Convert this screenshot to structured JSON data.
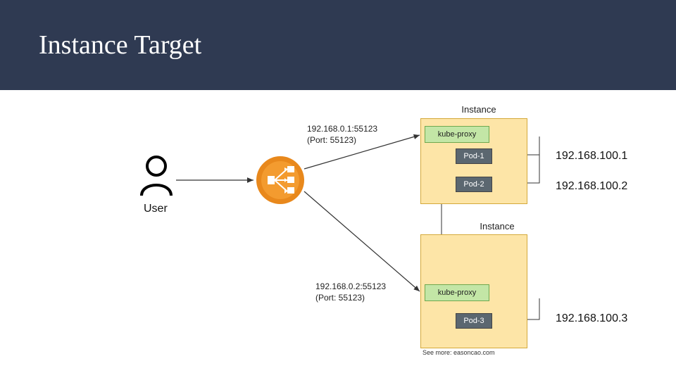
{
  "title": "Instance Target",
  "user_label": "User",
  "lb": {
    "routes": [
      {
        "addr": "192.168.0.1:55123",
        "port_note": "(Port: 55123)"
      },
      {
        "addr": "192.168.0.2:55123",
        "port_note": "(Port: 55123)"
      }
    ]
  },
  "instances": [
    {
      "label": "Instance",
      "kube": "kube-proxy",
      "pods": [
        {
          "name": "Pod-1",
          "ip": "192.168.100.1"
        },
        {
          "name": "Pod-2",
          "ip": "192.168.100.2"
        }
      ]
    },
    {
      "label": "Instance",
      "kube": "kube-proxy",
      "pods": [
        {
          "name": "Pod-3",
          "ip": "192.168.100.3"
        }
      ]
    }
  ],
  "footnote": "See more: easoncao.com"
}
